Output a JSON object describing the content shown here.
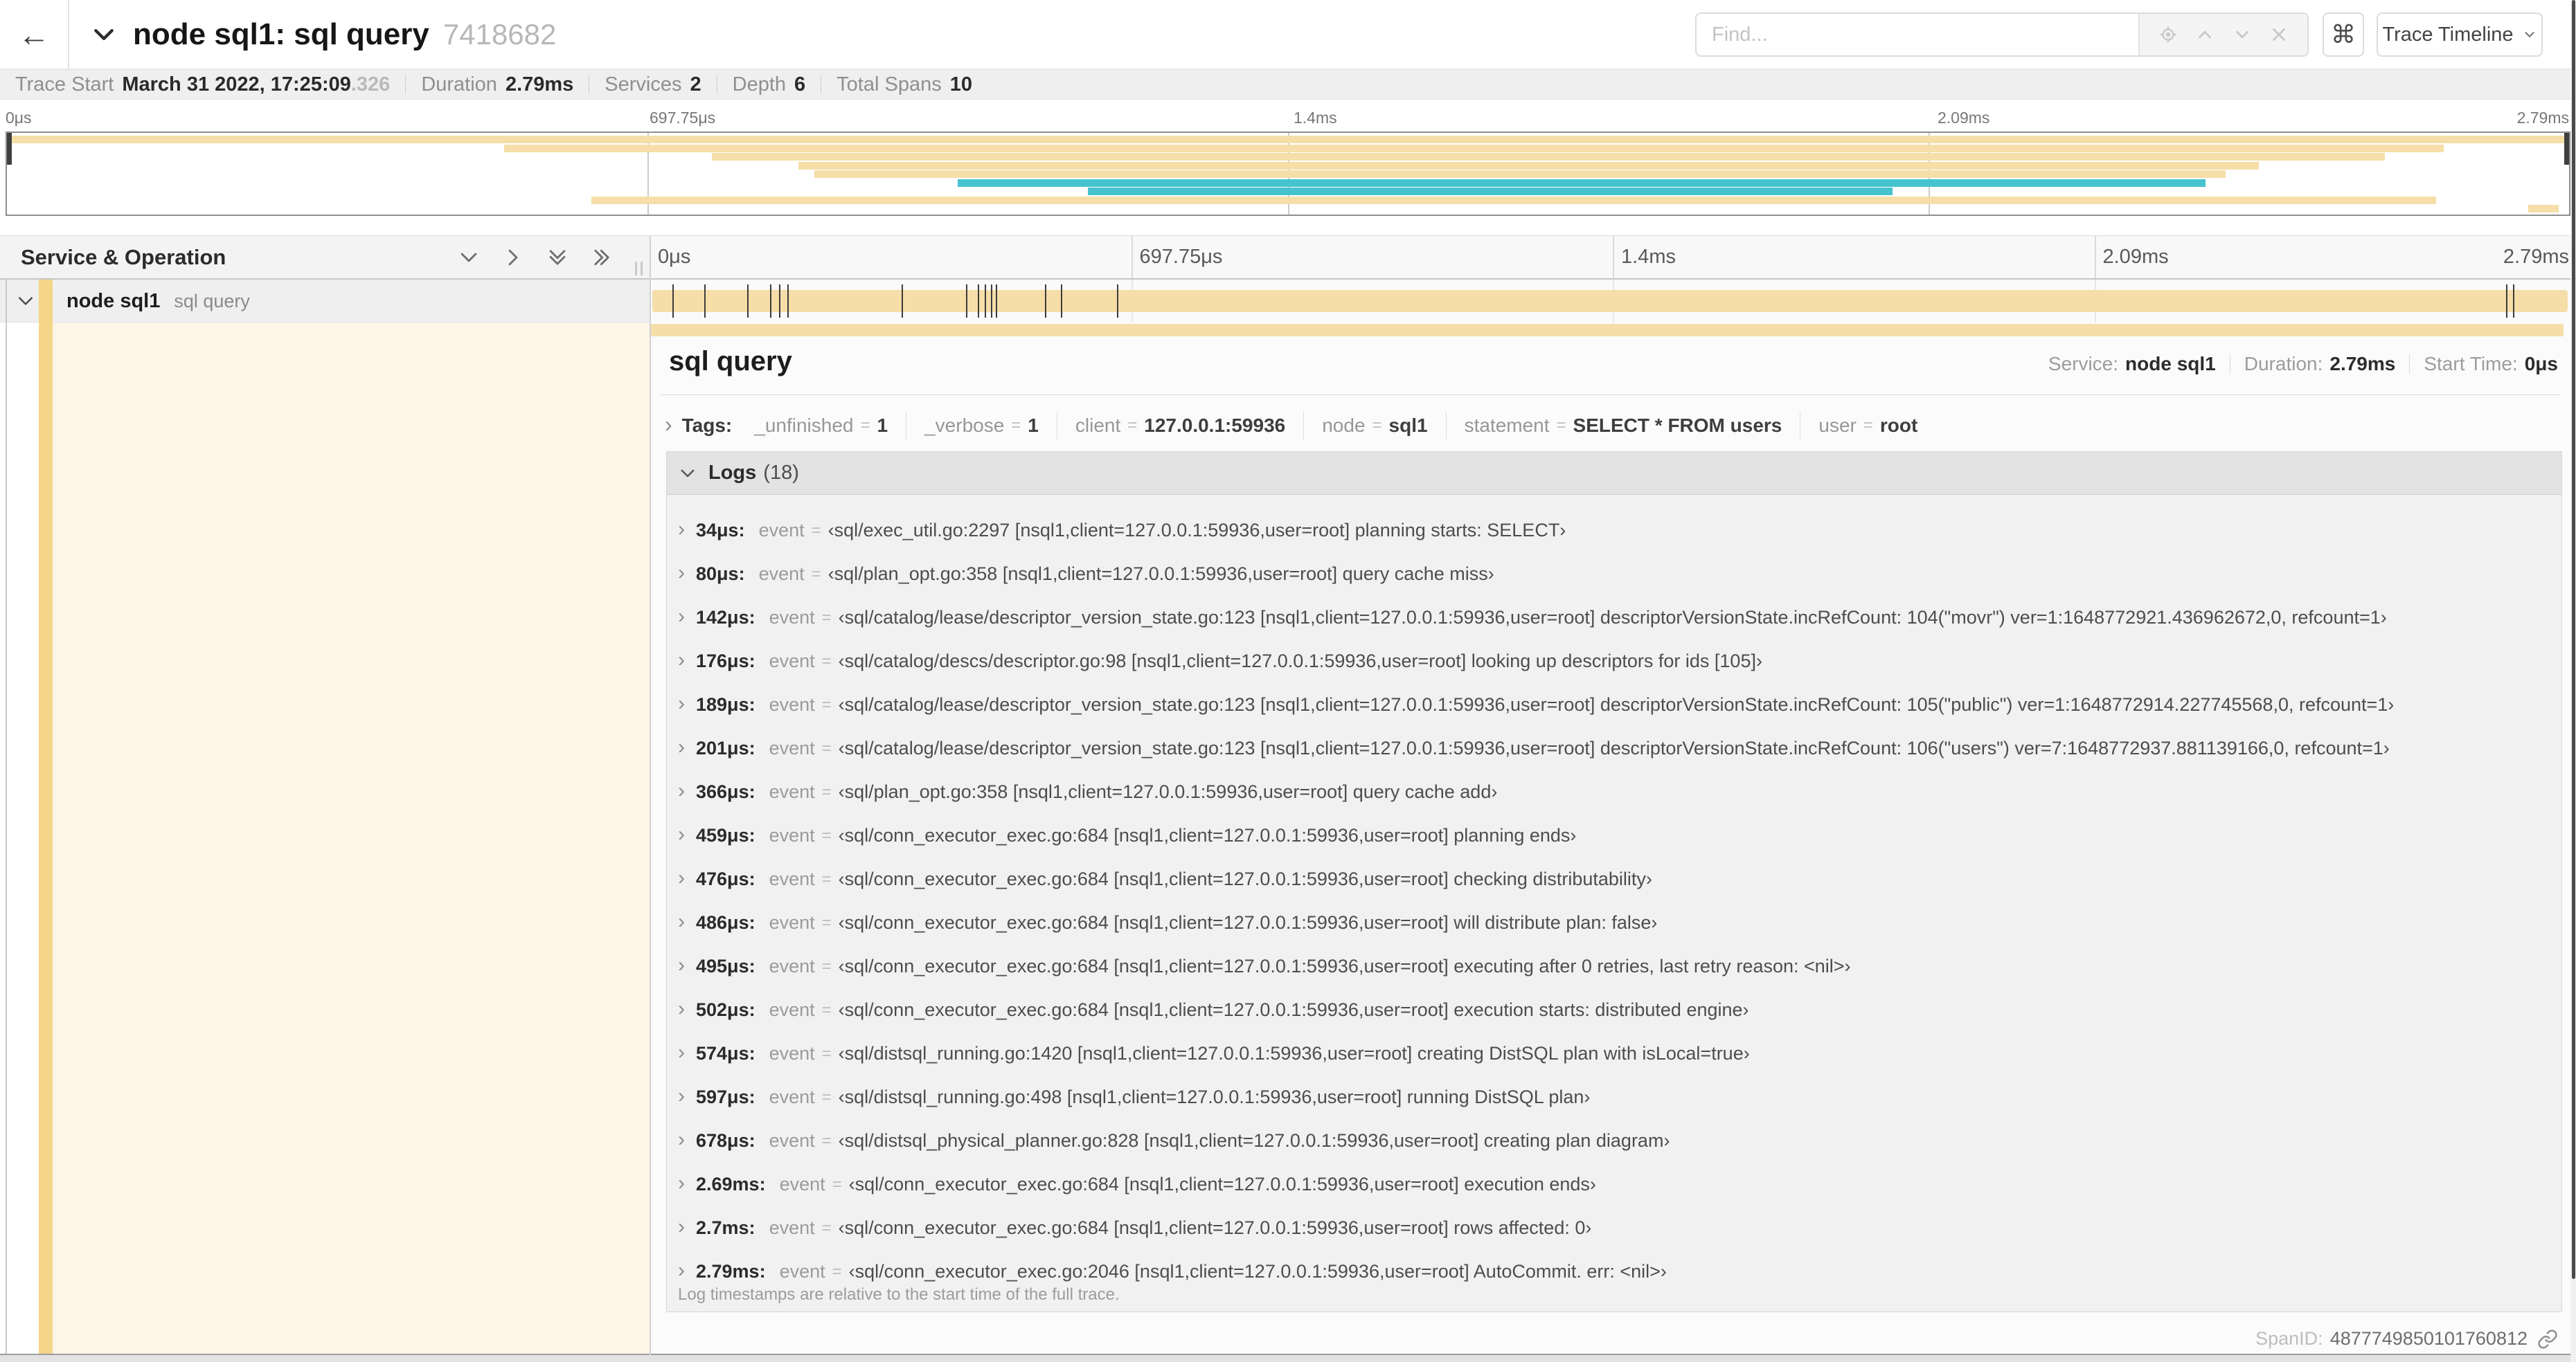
{
  "header": {
    "back_icon": "←",
    "title": "node sql1: sql query",
    "trace_id_short": "7418682",
    "find_placeholder": "Find...",
    "shortcut_key": "⌘",
    "view_dropdown": "Trace Timeline"
  },
  "summary": {
    "trace_start_label": "Trace Start",
    "trace_start_value": "March 31 2022, 17:25:09",
    "trace_start_ms": ".326",
    "duration_label": "Duration",
    "duration_value": "2.79ms",
    "services_label": "Services",
    "services_value": "2",
    "depth_label": "Depth",
    "depth_value": "6",
    "total_spans_label": "Total Spans",
    "total_spans_value": "10"
  },
  "timeline": {
    "ticks": [
      "0μs",
      "697.75μs",
      "1.4ms",
      "2.09ms",
      "2.79ms"
    ],
    "total_us": 2790,
    "colors": {
      "tan": "#f6dea9",
      "teal": "#46c4cd",
      "accent": "#f5d689",
      "cream": "#fdf6e8"
    },
    "minimap_spans": [
      {
        "start": 0,
        "end": 100,
        "color": "tan"
      },
      {
        "start": 19.4,
        "end": 95.1,
        "color": "tan"
      },
      {
        "start": 27.5,
        "end": 92.8,
        "color": "tan"
      },
      {
        "start": 30.9,
        "end": 87.9,
        "color": "tan"
      },
      {
        "start": 31.5,
        "end": 86.6,
        "color": "tan"
      },
      {
        "start": 37.1,
        "end": 85.8,
        "color": "teal"
      },
      {
        "start": 42.2,
        "end": 73.6,
        "color": "teal"
      },
      {
        "start": 22.8,
        "end": 94.8,
        "color": "tan"
      },
      {
        "start": 98.4,
        "end": 99.6,
        "color": "tan"
      }
    ]
  },
  "span_list": {
    "header_title": "Service & Operation",
    "row": {
      "service": "node sql1",
      "operation": "sql query"
    }
  },
  "detail": {
    "title": "sql query",
    "service_label": "Service:",
    "service_value": "node sql1",
    "duration_label": "Duration:",
    "duration_value": "2.79ms",
    "start_label": "Start Time:",
    "start_value": "0μs",
    "tags_label": "Tags:",
    "tags": [
      {
        "key": "_unfinished",
        "value": "1"
      },
      {
        "key": "_verbose",
        "value": "1"
      },
      {
        "key": "client",
        "value": "127.0.0.1:59936"
      },
      {
        "key": "node",
        "value": "sql1"
      },
      {
        "key": "statement",
        "value": "SELECT * FROM users"
      },
      {
        "key": "user",
        "value": "root"
      }
    ],
    "logs_label": "Logs",
    "logs_count": "(18)",
    "event_label": "event",
    "value_open": "‹",
    "value_close": "›",
    "logs": [
      {
        "t": "34μs:",
        "us": 34,
        "value": "sql/exec_util.go:2297 [nsql1,client=127.0.0.1:59936,user=root] planning starts: SELECT"
      },
      {
        "t": "80μs:",
        "us": 80,
        "value": "sql/plan_opt.go:358 [nsql1,client=127.0.0.1:59936,user=root] query cache miss"
      },
      {
        "t": "142μs:",
        "us": 142,
        "value": "sql/catalog/lease/descriptor_version_state.go:123 [nsql1,client=127.0.0.1:59936,user=root] descriptorVersionState.incRefCount: 104(\"movr\") ver=1:1648772921.436962672,0, refcount=1"
      },
      {
        "t": "176μs:",
        "us": 176,
        "value": "sql/catalog/descs/descriptor.go:98 [nsql1,client=127.0.0.1:59936,user=root] looking up descriptors for ids [105]"
      },
      {
        "t": "189μs:",
        "us": 189,
        "value": "sql/catalog/lease/descriptor_version_state.go:123 [nsql1,client=127.0.0.1:59936,user=root] descriptorVersionState.incRefCount: 105(\"public\") ver=1:1648772914.227745568,0, refcount=1"
      },
      {
        "t": "201μs:",
        "us": 201,
        "value": "sql/catalog/lease/descriptor_version_state.go:123 [nsql1,client=127.0.0.1:59936,user=root] descriptorVersionState.incRefCount: 106(\"users\") ver=7:1648772937.881139166,0, refcount=1"
      },
      {
        "t": "366μs:",
        "us": 366,
        "value": "sql/plan_opt.go:358 [nsql1,client=127.0.0.1:59936,user=root] query cache add"
      },
      {
        "t": "459μs:",
        "us": 459,
        "value": "sql/conn_executor_exec.go:684 [nsql1,client=127.0.0.1:59936,user=root] planning ends"
      },
      {
        "t": "476μs:",
        "us": 476,
        "value": "sql/conn_executor_exec.go:684 [nsql1,client=127.0.0.1:59936,user=root] checking distributability"
      },
      {
        "t": "486μs:",
        "us": 486,
        "value": "sql/conn_executor_exec.go:684 [nsql1,client=127.0.0.1:59936,user=root] will distribute plan: false"
      },
      {
        "t": "495μs:",
        "us": 495,
        "value": "sql/conn_executor_exec.go:684 [nsql1,client=127.0.0.1:59936,user=root] executing after 0 retries, last retry reason: <nil>"
      },
      {
        "t": "502μs:",
        "us": 502,
        "value": "sql/conn_executor_exec.go:684 [nsql1,client=127.0.0.1:59936,user=root] execution starts: distributed engine"
      },
      {
        "t": "574μs:",
        "us": 574,
        "value": "sql/distsql_running.go:1420 [nsql1,client=127.0.0.1:59936,user=root] creating DistSQL plan with isLocal=true"
      },
      {
        "t": "597μs:",
        "us": 597,
        "value": "sql/distsql_running.go:498 [nsql1,client=127.0.0.1:59936,user=root] running DistSQL plan"
      },
      {
        "t": "678μs:",
        "us": 678,
        "value": "sql/distsql_physical_planner.go:828 [nsql1,client=127.0.0.1:59936,user=root] creating plan diagram"
      },
      {
        "t": "2.69ms:",
        "us": 2690,
        "value": "sql/conn_executor_exec.go:684 [nsql1,client=127.0.0.1:59936,user=root] execution ends"
      },
      {
        "t": "2.7ms:",
        "us": 2700,
        "value": "sql/conn_executor_exec.go:684 [nsql1,client=127.0.0.1:59936,user=root] rows affected: 0"
      },
      {
        "t": "2.79ms:",
        "us": 2790,
        "value": "sql/conn_executor_exec.go:2046 [nsql1,client=127.0.0.1:59936,user=root] AutoCommit. err: <nil>"
      }
    ],
    "logs_footnote": "Log timestamps are relative to the start time of the full trace.",
    "spanid_label": "SpanID:",
    "spanid_value": "4877749850101760812"
  }
}
